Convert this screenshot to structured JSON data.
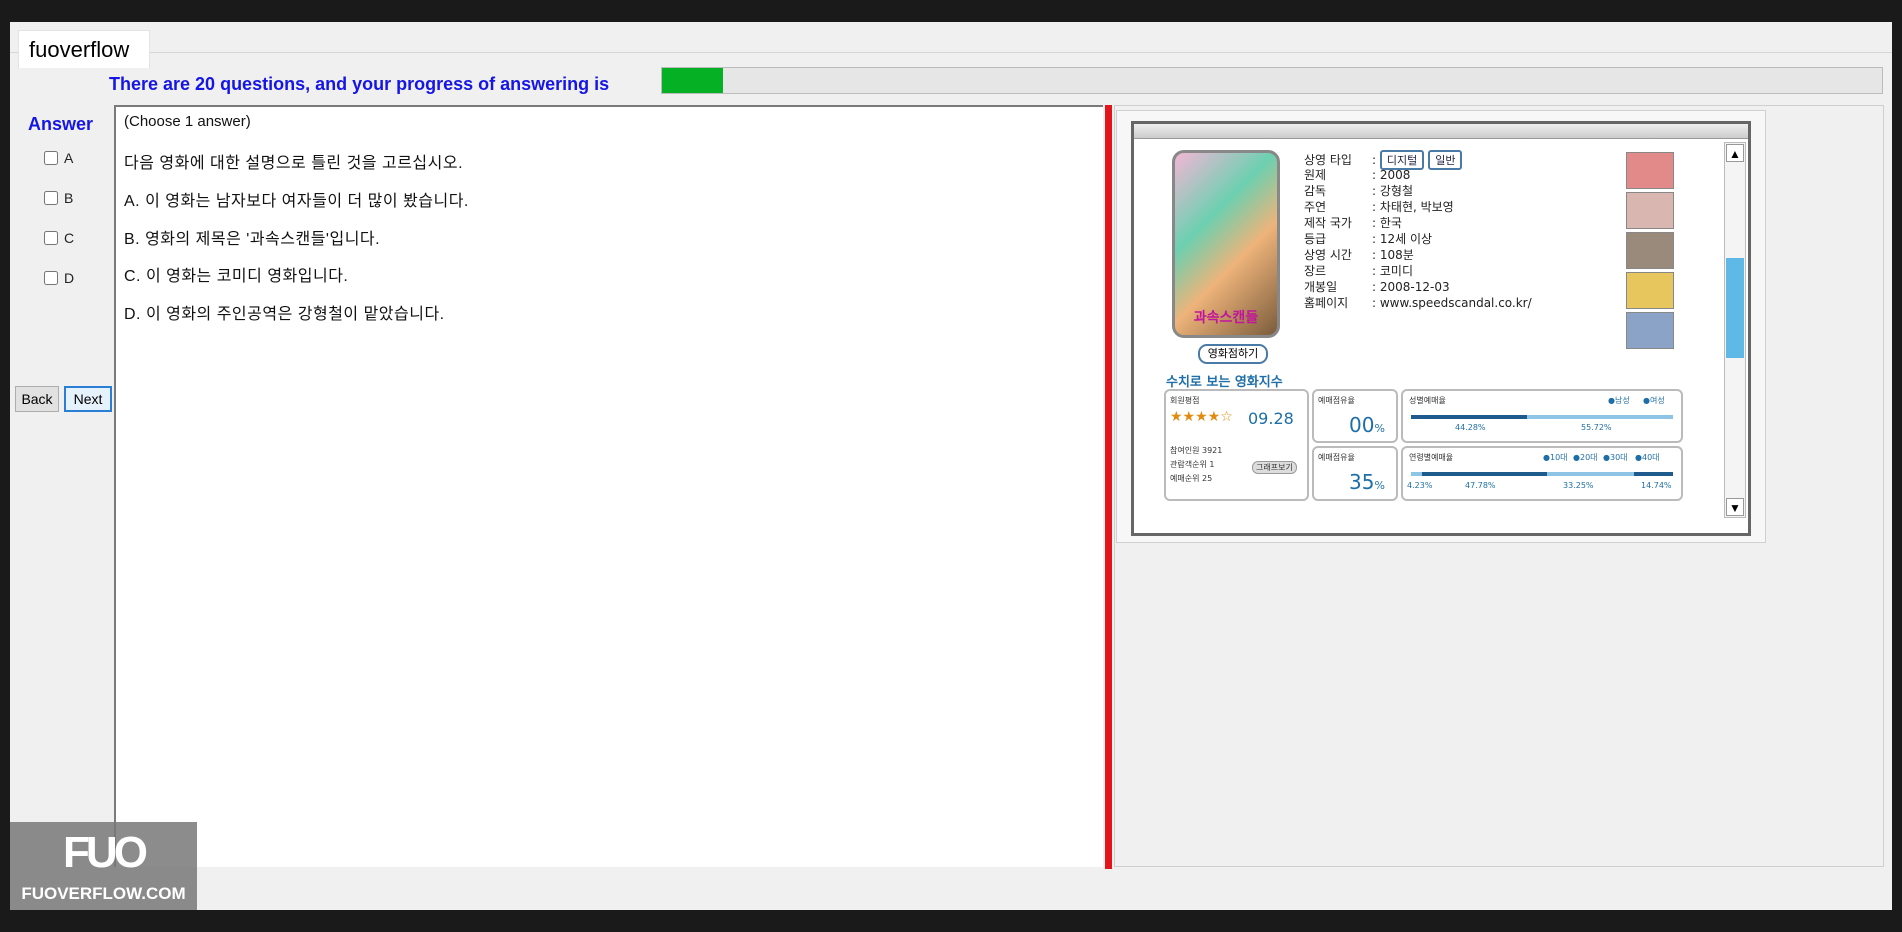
{
  "window": {
    "tab_label": "fuoverflow"
  },
  "progress": {
    "label": "There are 20 questions, and your progress of answering is",
    "fraction": 0.05,
    "fill_color": "#06b025"
  },
  "answer": {
    "title": "Answer",
    "options": [
      "A",
      "B",
      "C",
      "D"
    ]
  },
  "nav": {
    "back_label": "Back",
    "next_label": "Next"
  },
  "question": {
    "instruction": "(Choose 1 answer)",
    "prompt": "다음 영화에 대한 설명으로 틀린 것을 고르십시오.",
    "choices": [
      "A.  이 영화는 남자보다 여자들이 더 많이 봤습니다.",
      "B.  영화의 제목은 '과속스캔들'입니다.",
      "C.  이 영화는 코미디 영화입니다.",
      "D.  이 영화의 주인공역은 강형철이 맡았습니다."
    ]
  },
  "movie_image": {
    "poster_title": "과속스캔들",
    "poster_button": "영화점하기",
    "info": [
      {
        "key": "상영 타입",
        "value": "",
        "tags": [
          "디지털",
          "일반"
        ]
      },
      {
        "key": "원제",
        "value": ": 2008"
      },
      {
        "key": "감독",
        "value": ": 강형철"
      },
      {
        "key": "주연",
        "value": ": 차태현, 박보영"
      },
      {
        "key": "제작 국가",
        "value": ": 한국"
      },
      {
        "key": "등급",
        "value": ": 12세 이상"
      },
      {
        "key": "상영 시간",
        "value": ": 108분"
      },
      {
        "key": "장르",
        "value": ": 코미디"
      },
      {
        "key": "개봉일",
        "value": ": 2008-12-03"
      },
      {
        "key": "홈페이지",
        "value": ": www.speedscandal.co.kr/"
      }
    ],
    "index_title": "수치로 보는 영화지수",
    "rating": {
      "label": "회원평점",
      "stars": "★★★★☆",
      "score": "09.28"
    },
    "stats": [
      "참여인원   3921",
      "관람객순위  1",
      "예매순위    25"
    ],
    "graph_button": "그래프보기",
    "card2_label": "예매점유율",
    "card2_value": "00",
    "card3_label": "예매점유율",
    "card3_value": "35",
    "percent_sign": "%",
    "gender": {
      "label": "성별예매율",
      "legend": [
        "●남성",
        "●여성"
      ],
      "values": [
        "44.28%",
        "55.72%"
      ]
    },
    "age": {
      "label": "연령별예매율",
      "legend": [
        "●10대",
        "●20대",
        "●30대",
        "●40대"
      ],
      "values": [
        "4.23%",
        "47.78%",
        "33.25%",
        "14.74%"
      ]
    }
  }
}
